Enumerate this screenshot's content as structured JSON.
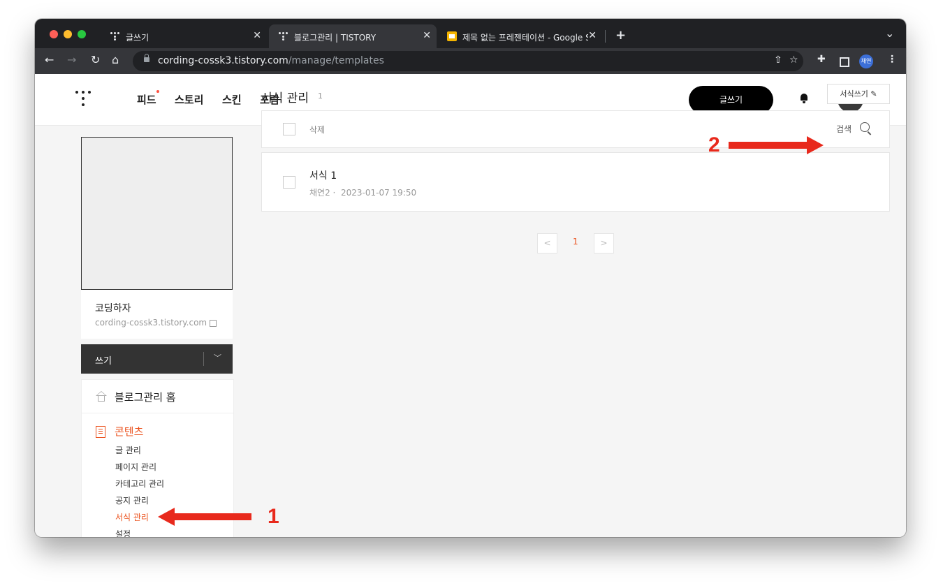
{
  "browser": {
    "tabs": [
      {
        "label": "글쓰기",
        "close": "✕"
      },
      {
        "label": "블로그관리 | TISTORY",
        "close": "✕"
      },
      {
        "label": "제목 없는 프레젠테이션 - Google S",
        "close": "✕"
      }
    ],
    "new_tab": "+",
    "tab_menu": "⌄",
    "url_host": "cording-cossk3.tistory.com",
    "url_path": "/manage/templates",
    "profile": "채연",
    "colors": {
      "chrome_dark": "#202124",
      "chrome_toolbar": "#35363a"
    }
  },
  "header": {
    "nav": [
      "피드",
      "스토리",
      "스킨",
      "포럼"
    ],
    "write_button": "글쓰기"
  },
  "sidebar": {
    "blog_name": "코딩하자",
    "blog_url": "cording-cossk3.tistory.com",
    "write_dropdown": "쓰기",
    "home": "블로그관리 홈",
    "section": "콘텐츠",
    "items": [
      "글 관리",
      "페이지 관리",
      "카테고리 관리",
      "공지 관리",
      "서식 관리",
      "설정"
    ],
    "active_item": "서식 관리"
  },
  "main": {
    "title": "서식 관리",
    "count": "1",
    "new_template_button": "서식쓰기",
    "delete_label": "삭제",
    "search_label": "검색",
    "templates": [
      {
        "title": "서식 1",
        "author": "채연2",
        "date": "2023-01-07 19:50"
      }
    ],
    "pagination": {
      "current": "1",
      "prev": "<",
      "next": ">"
    }
  },
  "annotations": [
    {
      "label": "1",
      "color": "#e8291c"
    },
    {
      "label": "2",
      "color": "#e8291c"
    }
  ],
  "accent_color": "#eb531f"
}
